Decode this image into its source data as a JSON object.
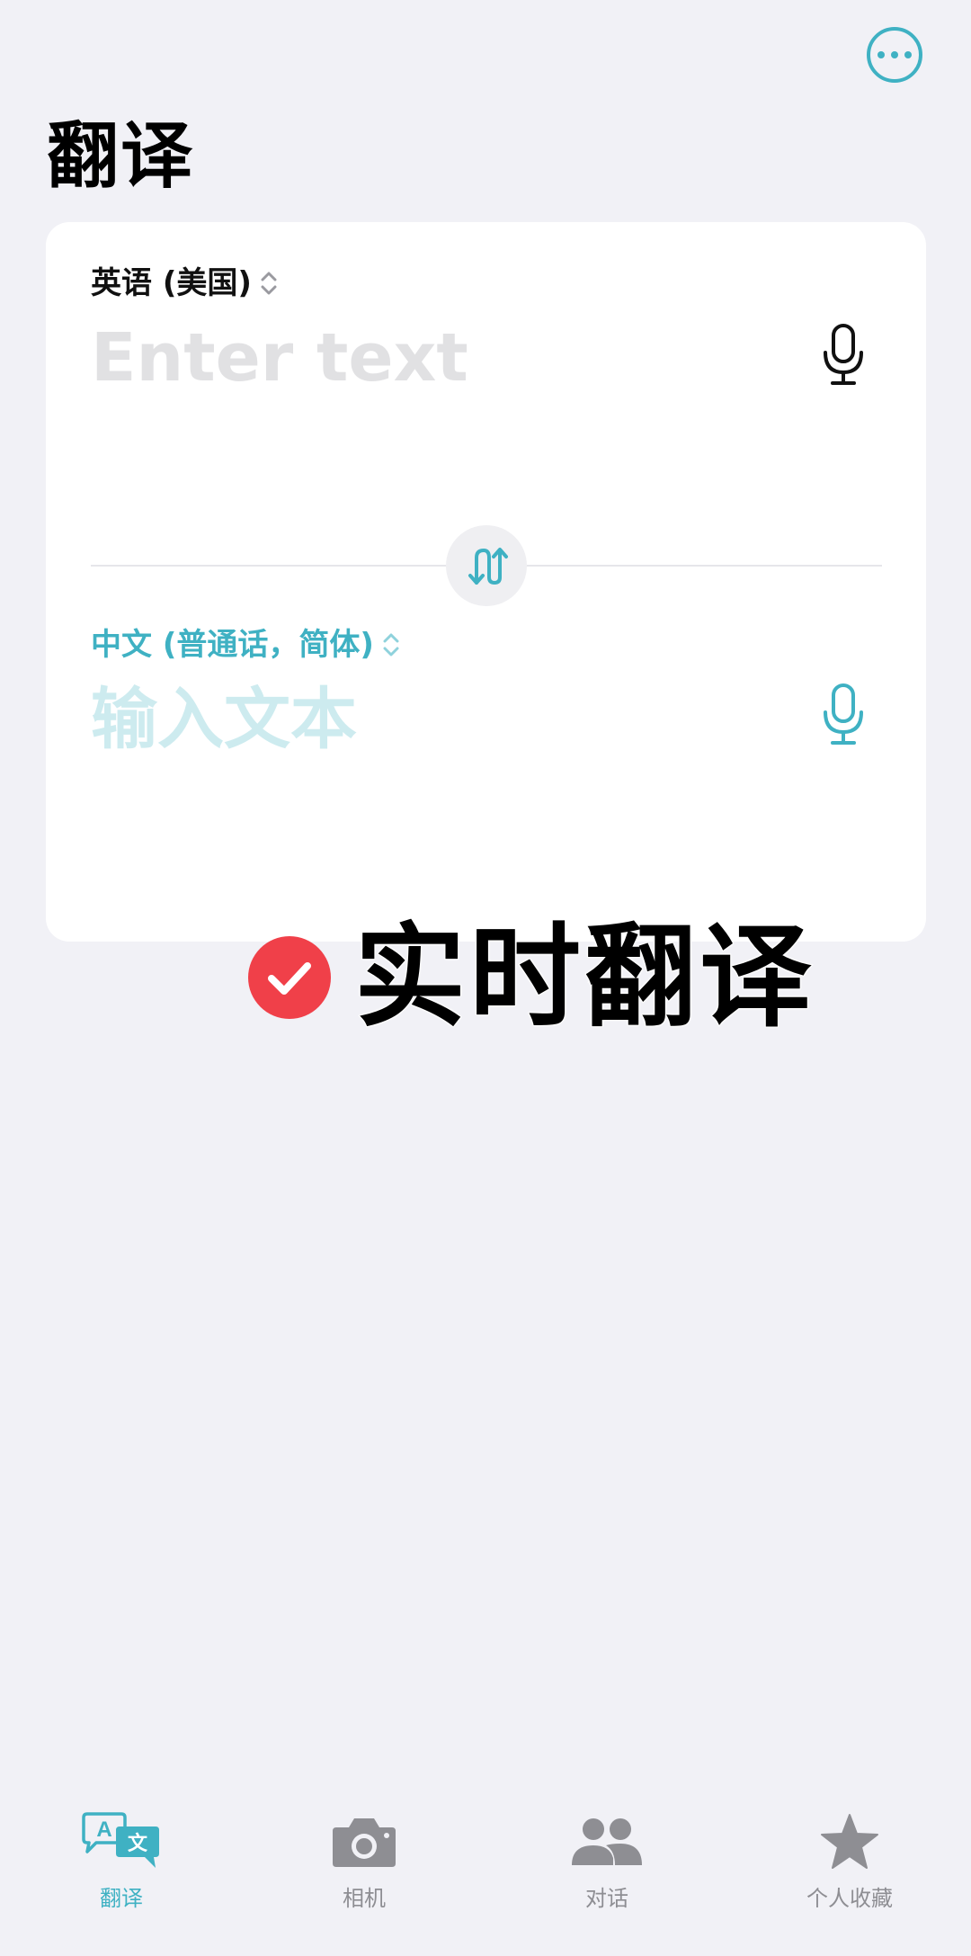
{
  "header": {
    "title": "翻译",
    "more_icon": "ellipsis-circle-icon"
  },
  "translator": {
    "source": {
      "language": "英语 (美国)",
      "placeholder": "Enter text",
      "mic_icon": "microphone-icon"
    },
    "swap_icon": "swap-arrows-icon",
    "target": {
      "language": "中文 (普通话，简体)",
      "placeholder": "输入文本",
      "mic_icon": "microphone-icon"
    }
  },
  "overlay": {
    "caption": "实时翻译",
    "badge_icon": "checkmark-circle-icon"
  },
  "tab_bar": {
    "items": [
      {
        "label": "翻译",
        "icon": "translate-bubbles-icon",
        "active": true
      },
      {
        "label": "相机",
        "icon": "camera-icon",
        "active": false
      },
      {
        "label": "对话",
        "icon": "people-icon",
        "active": false
      },
      {
        "label": "个人收藏",
        "icon": "star-icon",
        "active": false
      }
    ]
  },
  "colors": {
    "accent": "#3fb1c3",
    "background": "#f1f1f6",
    "card": "#ffffff",
    "badge_red": "#f04049",
    "inactive_tab": "#8e8e93"
  }
}
